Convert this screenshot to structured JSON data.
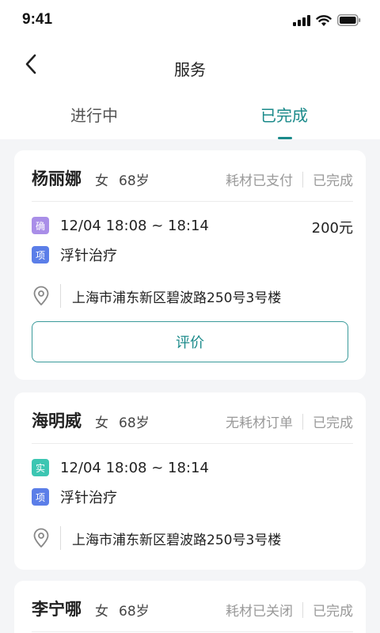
{
  "status_bar": {
    "time": "9:41"
  },
  "nav": {
    "title": "服务"
  },
  "tabs": [
    {
      "label": "进行中",
      "active": false
    },
    {
      "label": "已完成",
      "active": true
    }
  ],
  "colors": {
    "accent": "#1a8a8a",
    "background": "#f4f5f7"
  },
  "orders": [
    {
      "name": "杨丽娜",
      "gender": "女",
      "age": "68岁",
      "material_status": "耗材已支付",
      "order_status": "已完成",
      "time_badge": "确",
      "time": "12/04 18:08 ~ 18:14",
      "price": "200元",
      "item_badge": "项",
      "item": "浮针治疗",
      "address": "上海市浦东新区碧波路250号3号楼",
      "action_label": "评价"
    },
    {
      "name": "海明威",
      "gender": "女",
      "age": "68岁",
      "material_status": "无耗材订单",
      "order_status": "已完成",
      "time_badge": "实",
      "time": "12/04 18:08 ~ 18:14",
      "item_badge": "项",
      "item": "浮针治疗",
      "address": "上海市浦东新区碧波路250号3号楼"
    },
    {
      "name": "李宁哪",
      "gender": "女",
      "age": "68岁",
      "material_status": "耗材已关闭",
      "order_status": "已完成"
    }
  ]
}
